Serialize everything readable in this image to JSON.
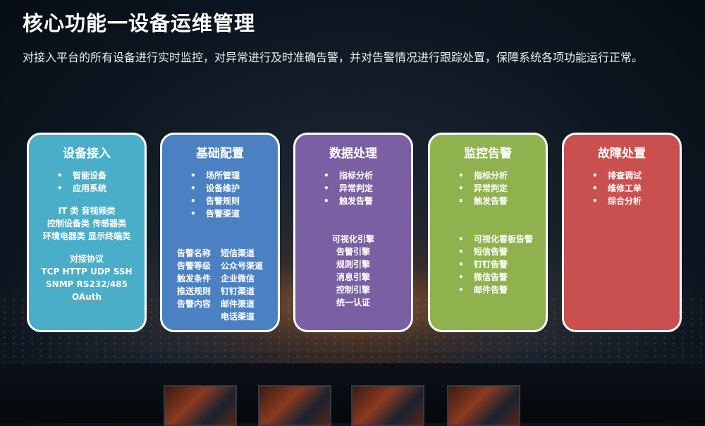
{
  "header": {
    "title": "核心功能一设备运维管理",
    "subtitle": "对接入平台的所有设备进行实时监控，对异常进行及时准确告警，并对告警情况进行跟踪处置，保障系统各项功能运行正常。"
  },
  "colors": {
    "card1": "#4aaec8",
    "card2": "#4b80c2",
    "card3": "#7a5fa3",
    "card4": "#8fb24e",
    "card5": "#c9504e"
  },
  "cards": [
    {
      "title": "设备接入",
      "bullets": [
        "智能设备",
        "应用系统"
      ],
      "lines1": [
        "IT 类  音视频类",
        "控制设备类  传感器类",
        "环境电器类  显示终端类"
      ],
      "lines2": [
        "对接协议",
        "TCP HTTP UDP SSH",
        "SNMP RS232/485",
        "OAuth"
      ]
    },
    {
      "title": "基础配置",
      "bullets": [
        "场所管理",
        "设备维护",
        "告警规则",
        "告警渠道"
      ],
      "col1": [
        "告警名称",
        "告警等级",
        "触发条件",
        "推送规则",
        "告警内容"
      ],
      "col2": [
        "短信渠道",
        "公众号渠道",
        "企业微信",
        "钉钉渠道",
        "邮件渠道",
        "电话渠道"
      ]
    },
    {
      "title": "数据处理",
      "bullets": [
        "指标分析",
        "异常判定",
        "触发告警"
      ],
      "lines": [
        "可视化引擎",
        "告警引擎",
        "规则引擎",
        "消息引擎",
        "控制引擎",
        "统一认证"
      ]
    },
    {
      "title": "监控告警",
      "bullets": [
        "指标分析",
        "异常判定",
        "触发告警"
      ],
      "bullets2": [
        "可视化看板告警",
        "短信告警",
        "钉钉告警",
        "微信告警",
        "邮件告警"
      ]
    },
    {
      "title": "故障处置",
      "bullets": [
        "排查调试",
        "维修工单",
        "综合分析"
      ]
    }
  ]
}
